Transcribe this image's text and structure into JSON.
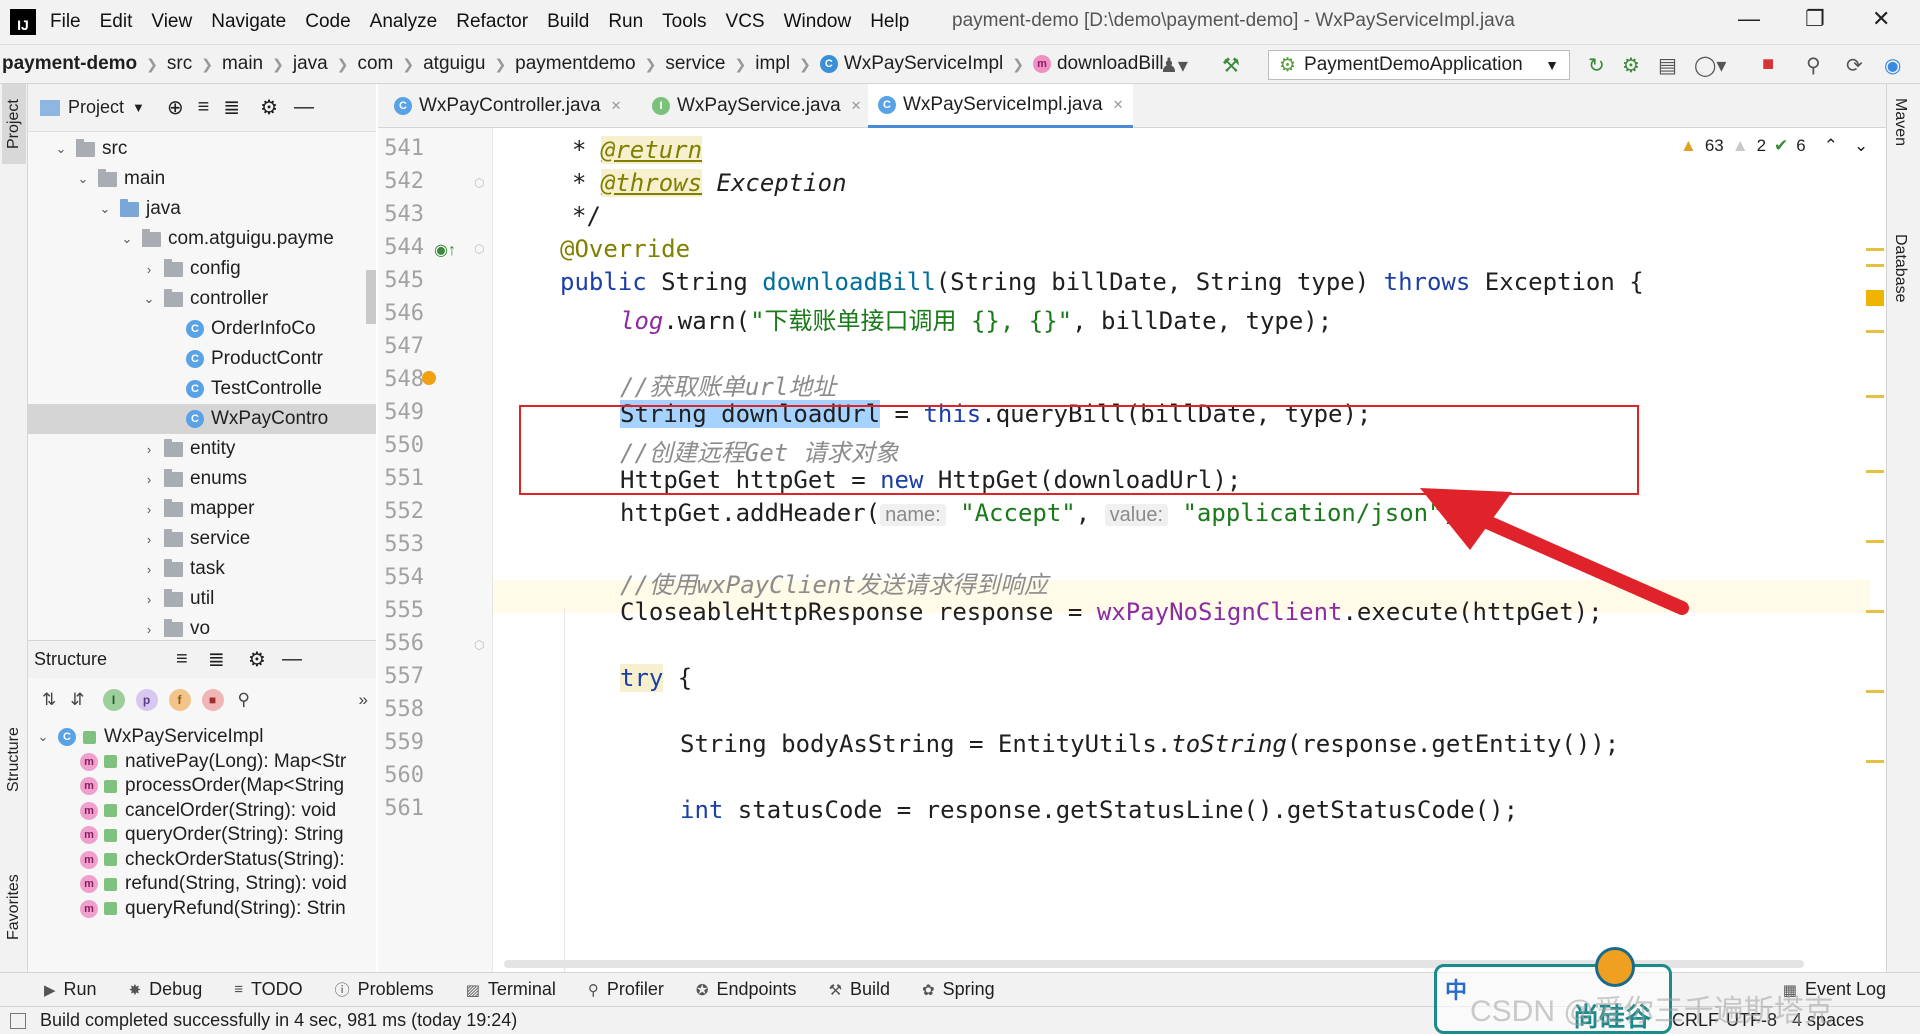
{
  "app": {
    "logo": "IJ",
    "menu": [
      "File",
      "Edit",
      "View",
      "Navigate",
      "Code",
      "Analyze",
      "Refactor",
      "Build",
      "Run",
      "Tools",
      "VCS",
      "Window",
      "Help"
    ],
    "window_title": "payment-demo [D:\\demo\\payment-demo] - WxPayServiceImpl.java"
  },
  "breadcrumb": [
    "payment-demo",
    "src",
    "main",
    "java",
    "com",
    "atguigu",
    "paymentdemo",
    "service",
    "impl",
    "WxPayServiceImpl",
    "downloadBill"
  ],
  "run_config": "PaymentDemoApplication",
  "project_panel": {
    "title": "Project",
    "tree": [
      {
        "label": "src",
        "depth": 0,
        "chev": "open",
        "kind": "folder"
      },
      {
        "label": "main",
        "depth": 1,
        "chev": "open",
        "kind": "folder"
      },
      {
        "label": "java",
        "depth": 2,
        "chev": "open",
        "kind": "folder-blue"
      },
      {
        "label": "com.atguigu.payme",
        "depth": 3,
        "chev": "open",
        "kind": "folder"
      },
      {
        "label": "config",
        "depth": 4,
        "chev": "closed",
        "kind": "folder"
      },
      {
        "label": "controller",
        "depth": 4,
        "chev": "open",
        "kind": "folder"
      },
      {
        "label": "OrderInfoCo",
        "depth": 5,
        "chev": "none",
        "kind": "class"
      },
      {
        "label": "ProductContr",
        "depth": 5,
        "chev": "none",
        "kind": "class"
      },
      {
        "label": "TestControlle",
        "depth": 5,
        "chev": "none",
        "kind": "class"
      },
      {
        "label": "WxPayContro",
        "depth": 5,
        "chev": "none",
        "kind": "class",
        "selected": true
      },
      {
        "label": "entity",
        "depth": 4,
        "chev": "closed",
        "kind": "folder"
      },
      {
        "label": "enums",
        "depth": 4,
        "chev": "closed",
        "kind": "folder"
      },
      {
        "label": "mapper",
        "depth": 4,
        "chev": "closed",
        "kind": "folder"
      },
      {
        "label": "service",
        "depth": 4,
        "chev": "closed",
        "kind": "folder"
      },
      {
        "label": "task",
        "depth": 4,
        "chev": "closed",
        "kind": "folder"
      },
      {
        "label": "util",
        "depth": 4,
        "chev": "closed",
        "kind": "folder"
      },
      {
        "label": "vo",
        "depth": 4,
        "chev": "closed",
        "kind": "folder"
      }
    ]
  },
  "structure_panel": {
    "title": "Structure",
    "root": "WxPayServiceImpl",
    "methods": [
      "nativePay(Long): Map<Str",
      "processOrder(Map<String",
      "cancelOrder(String): void",
      "queryOrder(String): String",
      "checkOrderStatus(String):",
      "refund(String, String): void",
      "queryRefund(String): Strin"
    ]
  },
  "tabs": [
    {
      "label": "WxPayController.java",
      "icon": "C"
    },
    {
      "label": "WxPayService.java",
      "icon": "I"
    },
    {
      "label": "WxPayServiceImpl.java",
      "icon": "C",
      "active": true
    }
  ],
  "inspections": {
    "warnings": "63",
    "weak_warnings": "2",
    "typos": "6"
  },
  "code": {
    "line_numbers": [
      "541",
      "542",
      "543",
      "544",
      "545",
      "546",
      "547",
      "548",
      "549",
      "550",
      "551",
      "552",
      "553",
      "554",
      "555",
      "556",
      "557",
      "558",
      "559",
      "560",
      "561"
    ],
    "l541_star": "* ",
    "l541_tag": "@return",
    "l542_star": "* ",
    "l542_tag": "@throws",
    "l542_rest": " Exception",
    "l543": "*/",
    "l544": "@Override",
    "l545_public": "public",
    "l545_type": " String ",
    "l545_name": "downloadBill",
    "l545_p1": "(String billDate, String type) ",
    "l545_throws": "throws",
    "l545_rest": " Exception {",
    "l546_log": "log",
    "l546_call": ".warn(",
    "l546_str": "\"下载账单接口调用 {}, {}\"",
    "l546_rest": ", billDate, type);",
    "l548": "//获取账单url地址",
    "l549_sel": "String downloadUrl",
    "l549_eq": " = ",
    "l549_this": "this",
    "l549_rest": ".queryBill(billDate, type);",
    "l550": "//创建远程Get 请求对象",
    "l551_a": "HttpGet httpGet = ",
    "l551_new": "new",
    "l551_b": " HttpGet(downloadUrl);",
    "l552_a": "httpGet.addHeader(",
    "l552_h1": "name:",
    "l552_s1": "\"Accept\"",
    "l552_c": ", ",
    "l552_h2": "value:",
    "l552_s2": "\"application/json\"",
    "l552_e": ");",
    "l554": "//使用wxPayClient发送请求得到响应",
    "l555_a": "CloseableHttpResponse response = ",
    "l555_fld": "wxPayNoSignClient",
    "l555_b": ".execute(httpGet);",
    "l557_try": "try",
    "l557_b": " {",
    "l559_a": "String bodyAsString = EntityUtils.",
    "l559_fn": "toString",
    "l559_b": "(response.getEntity());",
    "l561_int": "int",
    "l561_b": " statusCode = response.getStatusLine().getStatusCode();"
  },
  "right_strip": [
    "Maven",
    "Database"
  ],
  "left_strip": [
    "Project",
    "Structure",
    "Favorites"
  ],
  "bottom_tools": [
    "Run",
    "Debug",
    "TODO",
    "Problems",
    "Terminal",
    "Profiler",
    "Endpoints",
    "Build",
    "Spring",
    "Event Log"
  ],
  "status": {
    "message": "Build completed successfully in 4 sec, 981 ms (today 19:24)",
    "line_sep": "CRLF",
    "encoding": "UTF-8",
    "indent": "4 spaces"
  },
  "watermark": {
    "text": "CSDN @爱你三千遍斯塔克",
    "badge": "尚硅谷",
    "ime": "中"
  },
  "colors": {
    "accent": "#4a88d8",
    "annotation_box": "#e0222a",
    "arrow": "#e0222a",
    "selection": "#a6d2ff"
  }
}
